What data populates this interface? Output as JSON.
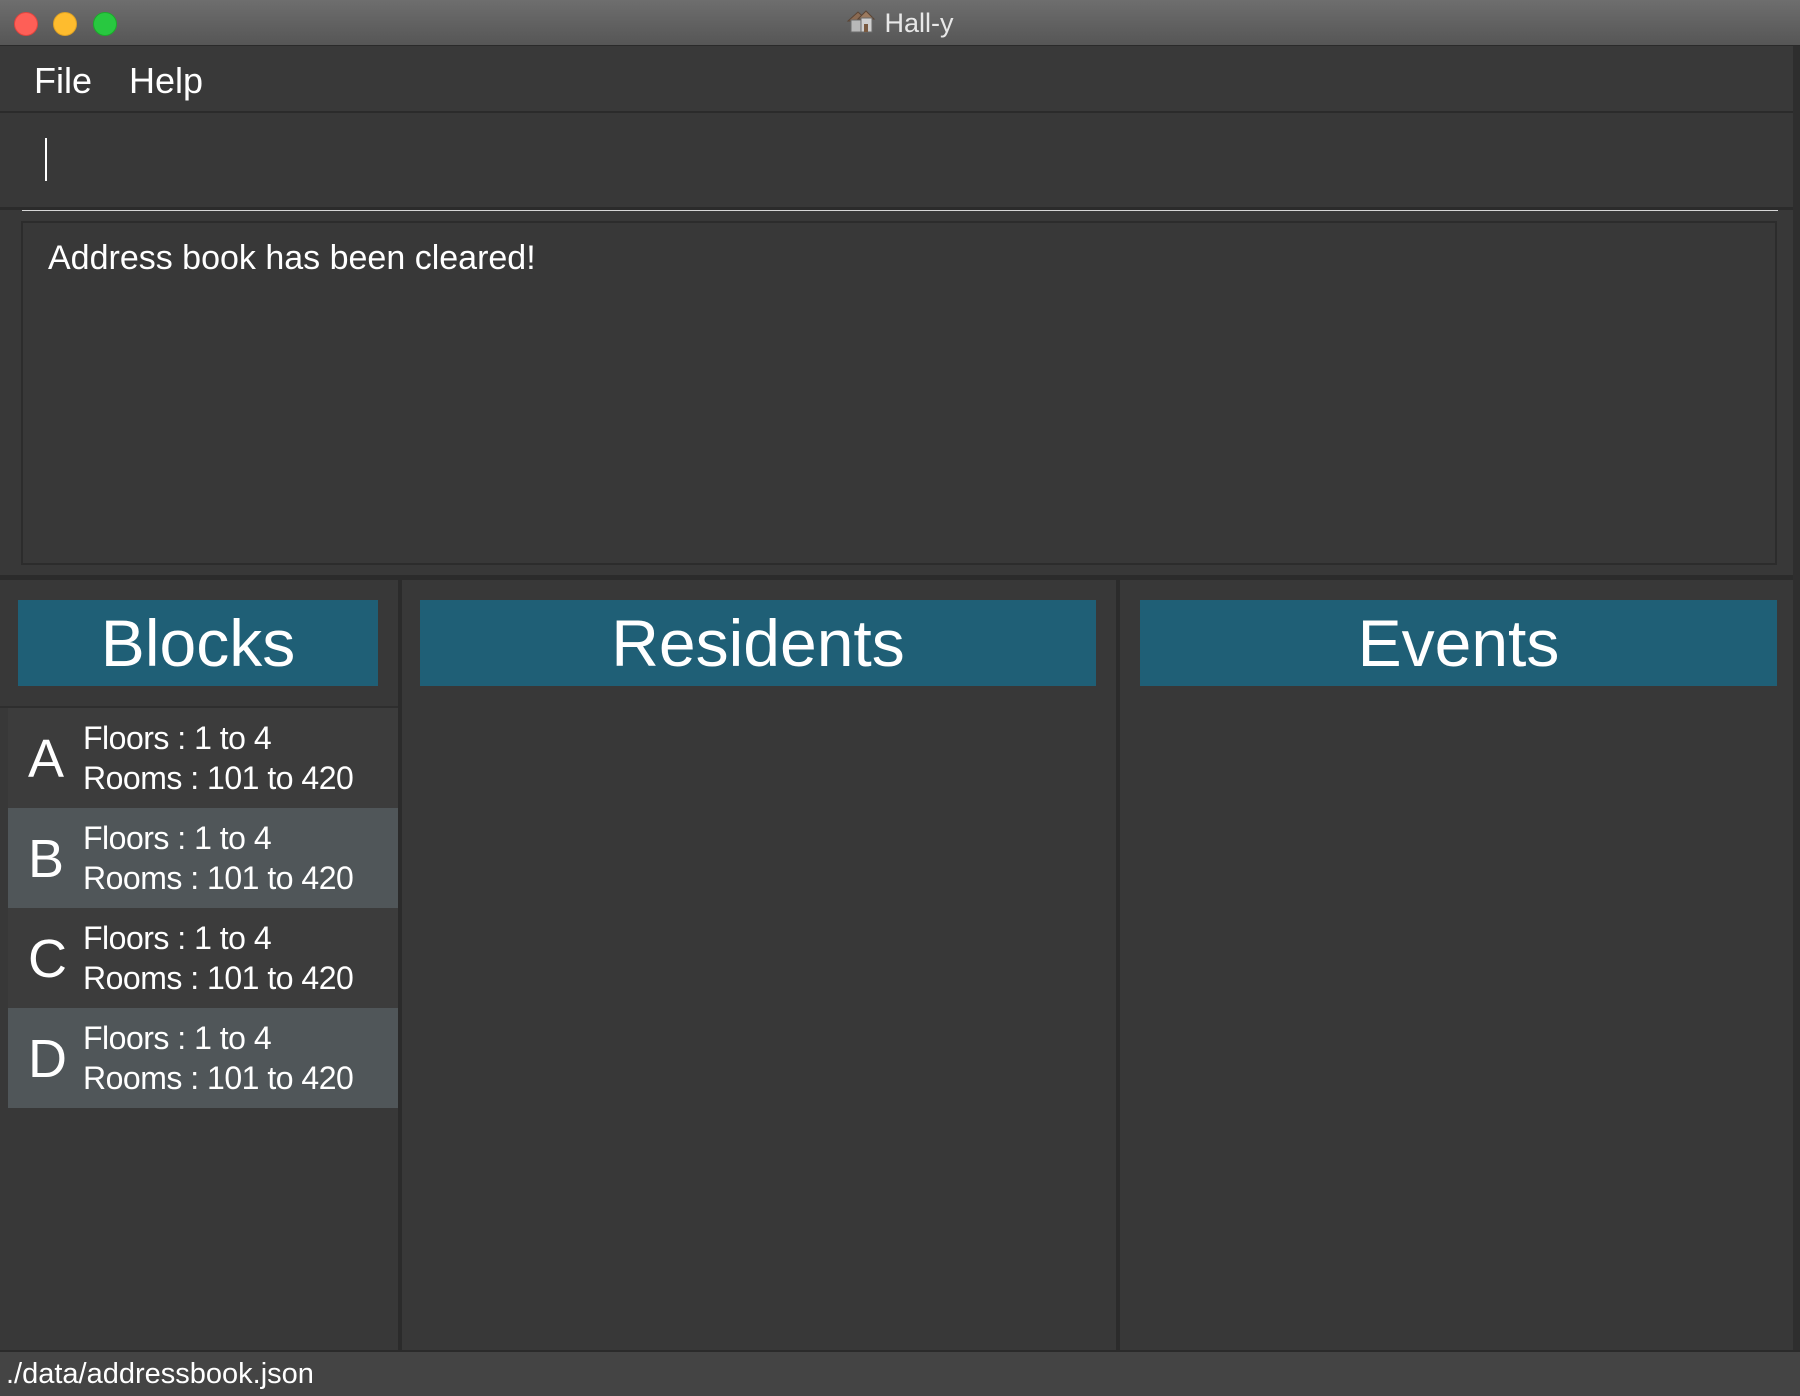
{
  "window": {
    "title": "Hall-y",
    "icon": "house-icon"
  },
  "menu": {
    "items": [
      {
        "label": "File"
      },
      {
        "label": "Help"
      }
    ]
  },
  "command": {
    "value": "",
    "placeholder": ""
  },
  "result": {
    "message": "Address book has been cleared!"
  },
  "panels": {
    "blocks": {
      "title": "Blocks",
      "items": [
        {
          "letter": "A",
          "floors": "Floors : 1 to 4",
          "rooms": "Rooms : 101 to 420"
        },
        {
          "letter": "B",
          "floors": "Floors : 1 to 4",
          "rooms": "Rooms : 101 to 420"
        },
        {
          "letter": "C",
          "floors": "Floors : 1 to 4",
          "rooms": "Rooms : 101 to 420"
        },
        {
          "letter": "D",
          "floors": "Floors : 1 to 4",
          "rooms": "Rooms : 101 to 420"
        }
      ]
    },
    "residents": {
      "title": "Residents",
      "items": []
    },
    "events": {
      "title": "Events",
      "items": []
    }
  },
  "status": {
    "path": "./data/addressbook.json"
  },
  "colors": {
    "header": "#1f5f76",
    "background": "#383838",
    "card_alt": "#505659"
  }
}
